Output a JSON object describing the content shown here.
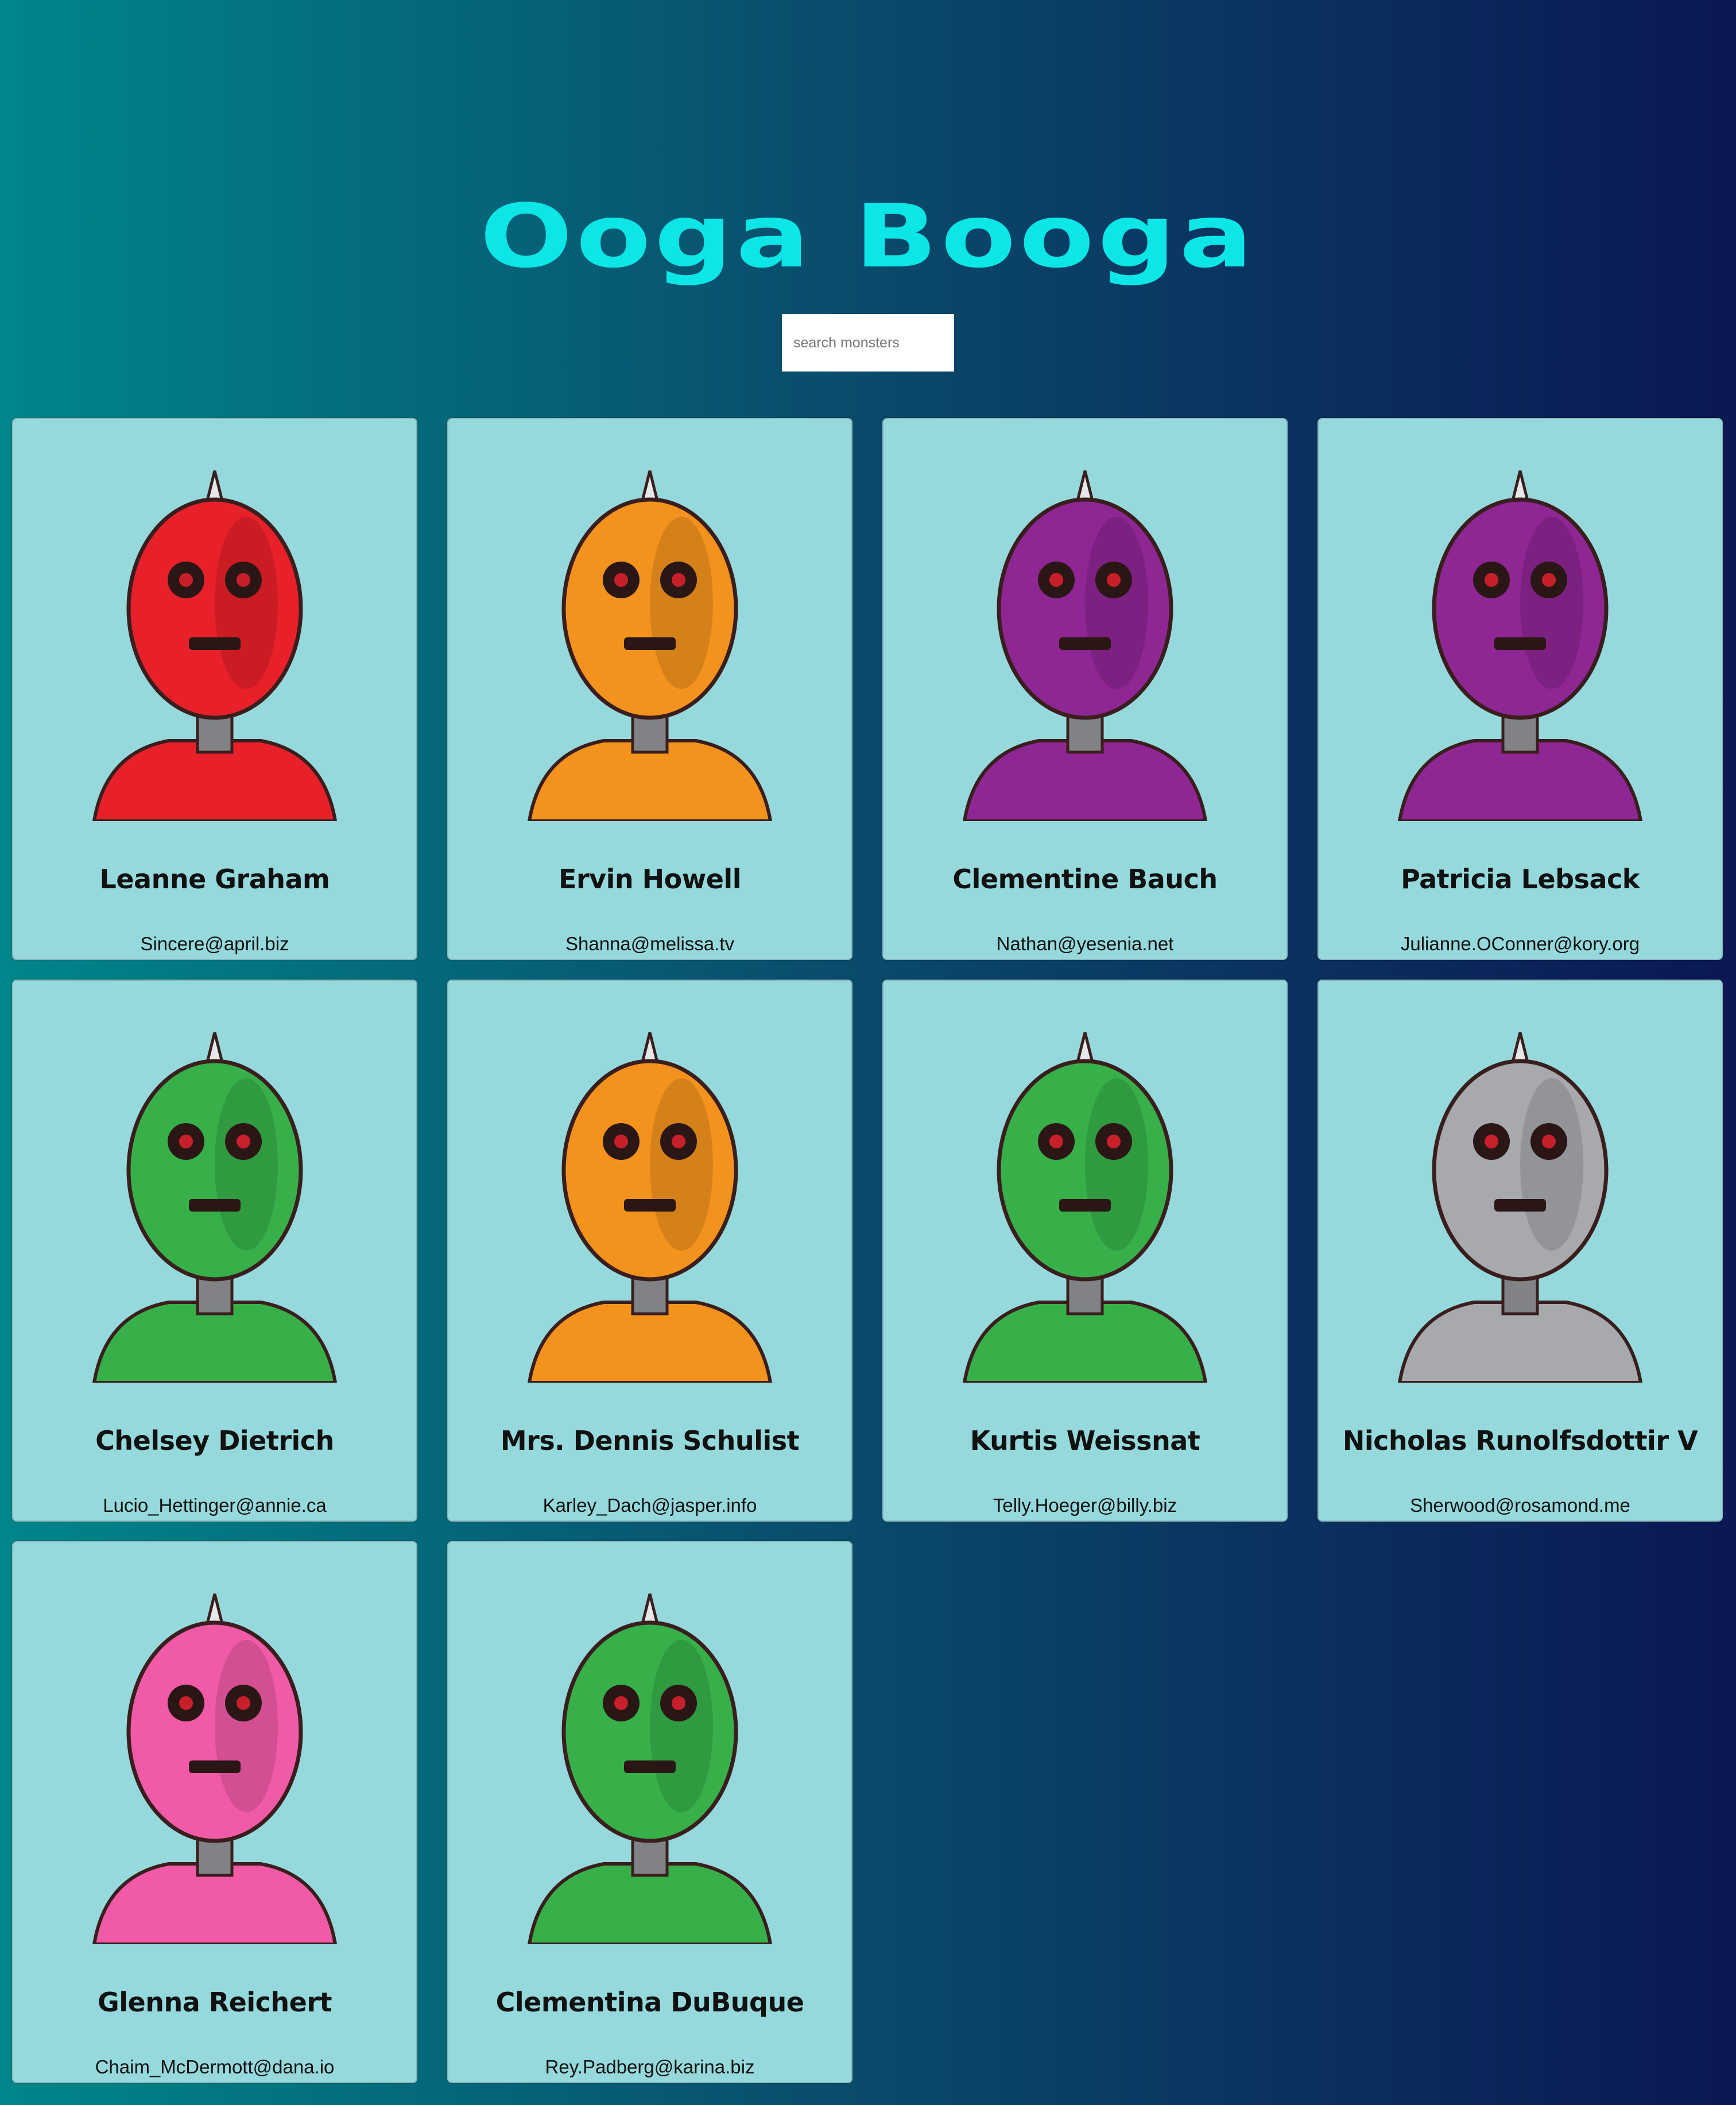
{
  "app": {
    "title": "Ooga Booga"
  },
  "search": {
    "placeholder": "search monsters",
    "value": ""
  },
  "monsters": [
    {
      "name": "Leanne Graham",
      "email": "Sincere@april.biz",
      "color": "#e8202a",
      "icon": "red-robot-icon"
    },
    {
      "name": "Ervin Howell",
      "email": "Shanna@melissa.tv",
      "color": "#f3931e",
      "icon": "orange-robot-icon"
    },
    {
      "name": "Clementine Bauch",
      "email": "Nathan@yesenia.net",
      "color": "#8e2693",
      "icon": "purple-robot-icon"
    },
    {
      "name": "Patricia Lebsack",
      "email": "Julianne.OConner@kory.org",
      "color": "#8e2693",
      "icon": "purple-robot-icon"
    },
    {
      "name": "Chelsey Dietrich",
      "email": "Lucio_Hettinger@annie.ca",
      "color": "#37b04a",
      "icon": "green-robot-icon"
    },
    {
      "name": "Mrs. Dennis Schulist",
      "email": "Karley_Dach@jasper.info",
      "color": "#f3931e",
      "icon": "orange-robot-icon"
    },
    {
      "name": "Kurtis Weissnat",
      "email": "Telly.Hoeger@billy.biz",
      "color": "#37b04a",
      "icon": "green-robot-icon"
    },
    {
      "name": "Nicholas Runolfsdottir V",
      "email": "Sherwood@rosamond.me",
      "color": "#a7a9ac",
      "icon": "grey-robot-icon"
    },
    {
      "name": "Glenna Reichert",
      "email": "Chaim_McDermott@dana.io",
      "color": "#f05aa6",
      "icon": "pink-robot-icon"
    },
    {
      "name": "Clementina DuBuque",
      "email": "Rey.Padberg@karina.biz",
      "color": "#37b04a",
      "icon": "green-robot-icon"
    }
  ]
}
